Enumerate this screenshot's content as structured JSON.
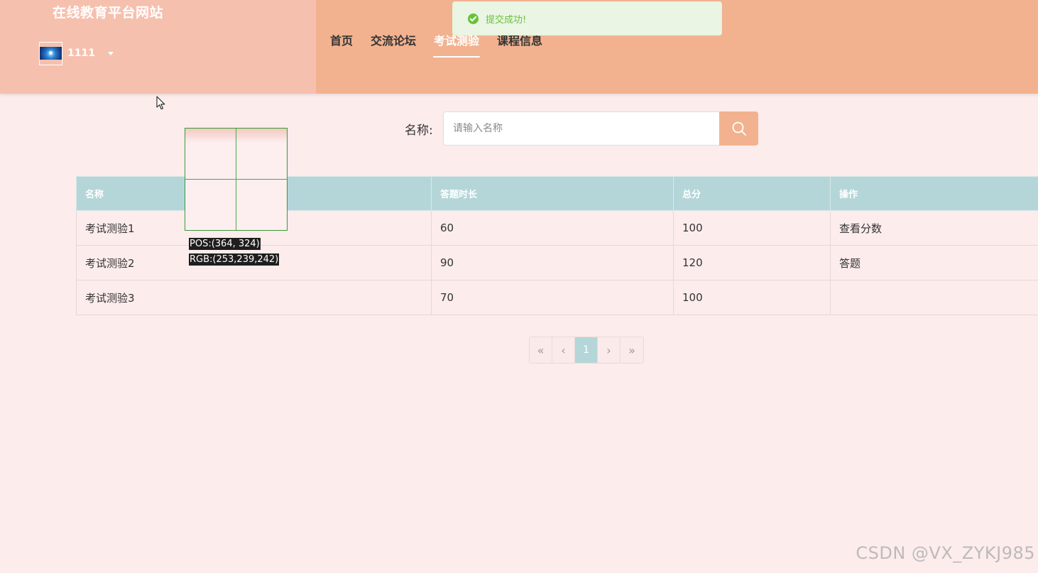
{
  "header": {
    "site_title": "在线教育平台网站",
    "username": "1111",
    "nav": [
      {
        "label": "首页"
      },
      {
        "label": "交流论坛"
      },
      {
        "label": "考试测验"
      },
      {
        "label": "课程信息"
      }
    ],
    "active_nav": "考试测验"
  },
  "toast": {
    "message": "提交成功!",
    "type": "success"
  },
  "search": {
    "label": "名称:",
    "placeholder": "请输入名称",
    "value": ""
  },
  "table": {
    "columns": [
      "名称",
      "答题时长",
      "总分",
      "操作"
    ],
    "rows": [
      {
        "name": "考试测验1",
        "duration": "60",
        "score": "100",
        "action": "查看分数"
      },
      {
        "name": "考试测验2",
        "duration": "90",
        "score": "120",
        "action": "答题"
      },
      {
        "name": "考试测验3",
        "duration": "70",
        "score": "100",
        "action": ""
      }
    ]
  },
  "pagination": {
    "first": "«",
    "prev": "‹",
    "current": "1",
    "next": "›",
    "last": "»"
  },
  "picker": {
    "pos_text": "POS:(364, 324)",
    "rgb_text": "RGB:(253,239,242)"
  },
  "watermark": "CSDN @VX_ZYKJ985",
  "colors": {
    "header_bg": "#f2b28f",
    "brand_bg": "#f6c0ae",
    "page_bg": "#fcecec",
    "table_header": "#b5d6d8",
    "success": "#67c23a",
    "accent": "#f2b28f"
  }
}
